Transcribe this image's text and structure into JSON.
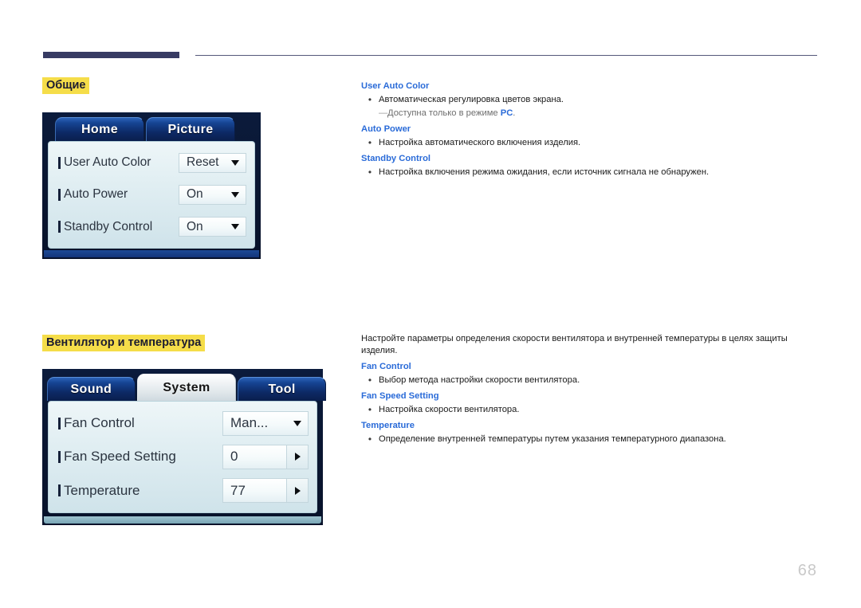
{
  "page": {
    "number": "68"
  },
  "sections": [
    {
      "heading": "Общие",
      "osd": {
        "tabs": [
          {
            "label": "Home",
            "active": false
          },
          {
            "label": "Picture",
            "active": false
          }
        ],
        "rows": [
          {
            "label": "User Auto Color",
            "value": "Reset",
            "control": "dropdown",
            "icon": "chevron-down-icon"
          },
          {
            "label": "Auto Power",
            "value": "On",
            "control": "dropdown",
            "icon": "chevron-down-icon"
          },
          {
            "label": "Standby Control",
            "value": "On",
            "control": "dropdown",
            "icon": "chevron-down-icon"
          }
        ]
      },
      "text": {
        "intro": "",
        "terms": [
          {
            "term": "User Auto Color",
            "bullets": [
              "Автоматическая регулировка цветов экрана."
            ],
            "note_prefix": "Доступна только в режиме ",
            "note_bold": "PC",
            "note_suffix": "."
          },
          {
            "term": "Auto Power",
            "bullets": [
              "Настройка автоматического включения изделия."
            ]
          },
          {
            "term": "Standby Control",
            "bullets": [
              "Настройка включения режима ожидания, если источник сигнала не обнаружен."
            ]
          }
        ]
      }
    },
    {
      "heading": "Вентилятор и температура",
      "osd": {
        "tabs": [
          {
            "label": "Sound",
            "active": false
          },
          {
            "label": "System",
            "active": true
          },
          {
            "label": "Tool",
            "active": false
          }
        ],
        "rows": [
          {
            "label": "Fan Control",
            "value": "Man...",
            "control": "dropdown",
            "icon": "chevron-down-icon"
          },
          {
            "label": "Fan Speed Setting",
            "value": "0",
            "control": "stepper",
            "icon": "chevron-right-icon"
          },
          {
            "label": "Temperature",
            "value": "77",
            "control": "stepper",
            "icon": "chevron-right-icon"
          }
        ]
      },
      "text": {
        "intro": "Настройте параметры определения скорости вентилятора и внутренней температуры в целях защиты изделия.",
        "terms": [
          {
            "term": "Fan Control",
            "bullets": [
              "Выбор метода настройки скорости вентилятора."
            ]
          },
          {
            "term": "Fan Speed Setting",
            "bullets": [
              "Настройка скорости вентилятора."
            ]
          },
          {
            "term": "Temperature",
            "bullets": [
              "Определение внутренней температуры путем указания температурного диапазона."
            ]
          }
        ]
      }
    }
  ],
  "colors": {
    "heading_highlight": "#f5dd49",
    "term_blue": "#2a6bd8",
    "rule_navy": "#373b63",
    "page_number_gray": "#c9c9c9"
  }
}
